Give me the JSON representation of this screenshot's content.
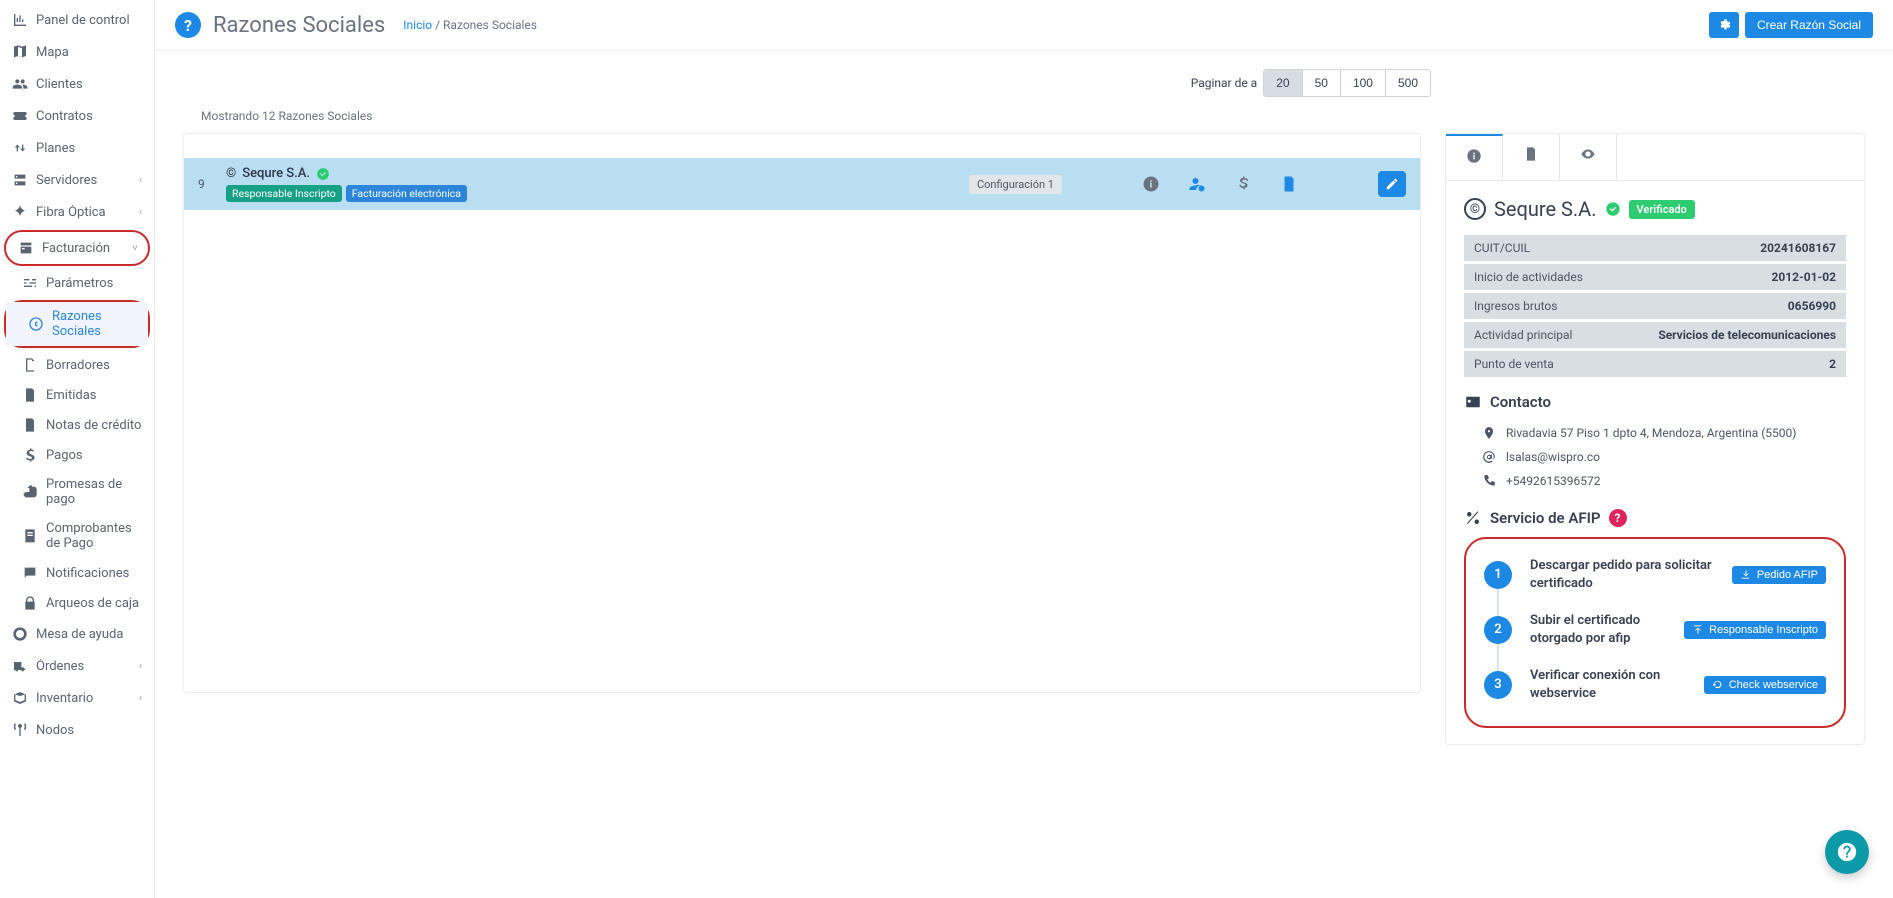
{
  "header": {
    "title": "Razones Sociales",
    "breadcrumb_home": "Inicio",
    "breadcrumb_sep": " / ",
    "breadcrumb_current": "Razones Sociales",
    "settings_icon": "gear-icon",
    "create_button": "Crear Razón Social"
  },
  "sidebar": {
    "items": [
      {
        "label": "Panel de control",
        "icon": "bar-chart"
      },
      {
        "label": "Mapa",
        "icon": "map"
      },
      {
        "label": "Clientes",
        "icon": "users"
      },
      {
        "label": "Contratos",
        "icon": "ticket"
      },
      {
        "label": "Planes",
        "icon": "swap"
      },
      {
        "label": "Servidores",
        "icon": "server",
        "chev": "‹"
      },
      {
        "label": "Fibra Óptica",
        "icon": "fiber",
        "chev": "‹"
      },
      {
        "label": "Facturación",
        "icon": "invoice",
        "chev": "˅",
        "expanded": true,
        "circled": true,
        "subs": [
          {
            "label": "Parámetros",
            "icon": "sliders"
          },
          {
            "label": "Razones Sociales",
            "icon": "copyright",
            "active": true,
            "circled": true
          },
          {
            "label": "Borradores",
            "icon": "draft"
          },
          {
            "label": "Emitidas",
            "icon": "file"
          },
          {
            "label": "Notas de crédito",
            "icon": "file-text"
          },
          {
            "label": "Pagos",
            "icon": "dollar"
          },
          {
            "label": "Promesas de pago",
            "icon": "hand"
          },
          {
            "label": "Comprobantes de Pago",
            "icon": "receipt"
          },
          {
            "label": "Notificaciones",
            "icon": "chat"
          },
          {
            "label": "Arqueos de caja",
            "icon": "lock"
          }
        ]
      },
      {
        "label": "Mesa de ayuda",
        "icon": "life-ring"
      },
      {
        "label": "Órdenes",
        "icon": "truck",
        "chev": "‹"
      },
      {
        "label": "Inventario",
        "icon": "box",
        "chev": "‹"
      },
      {
        "label": "Nodos",
        "icon": "antenna"
      }
    ]
  },
  "pager": {
    "label": "Paginar de a",
    "options": [
      "20",
      "50",
      "100",
      "500"
    ],
    "active": "20",
    "caption": "Mostrando 12 Razones Sociales"
  },
  "row": {
    "index": "9",
    "copyright_icon": "©",
    "name": "Sequre S.A.",
    "badges": [
      "Responsable Inscripto",
      "Facturación electrónica"
    ],
    "chip": "Configuración 1"
  },
  "detail": {
    "title_icon": "©",
    "title": "Sequre S.A.",
    "verified_label": "Verificado",
    "kv": [
      {
        "k": "CUIT/CUIL",
        "v": "20241608167"
      },
      {
        "k": "Inicio de actividades",
        "v": "2012-01-02"
      },
      {
        "k": "Ingresos brutos",
        "v": "0656990"
      },
      {
        "k": "Actividad principal",
        "v": "Servicios de telecomunicaciones"
      },
      {
        "k": "Punto de venta",
        "v": "2"
      }
    ],
    "contact_header": "Contacto",
    "contact": {
      "address": "Rivadavia 57 Piso 1 dpto 4, Mendoza, Argentina (5500)",
      "email": "lsalas@wispro.co",
      "phone": "+5492615396572"
    },
    "afip_header": "Servicio de AFIP",
    "steps": [
      {
        "n": "1",
        "text": "Descargar pedido para solicitar certificado",
        "btn": "Pedido AFIP",
        "btn_icon": "download"
      },
      {
        "n": "2",
        "text": "Subir el certificado otorgado por afip",
        "btn": "Responsable Inscripto",
        "btn_icon": "upload"
      },
      {
        "n": "3",
        "text": "Verificar conexión con webservice",
        "btn": "Check webservice",
        "btn_icon": "refresh"
      }
    ]
  }
}
